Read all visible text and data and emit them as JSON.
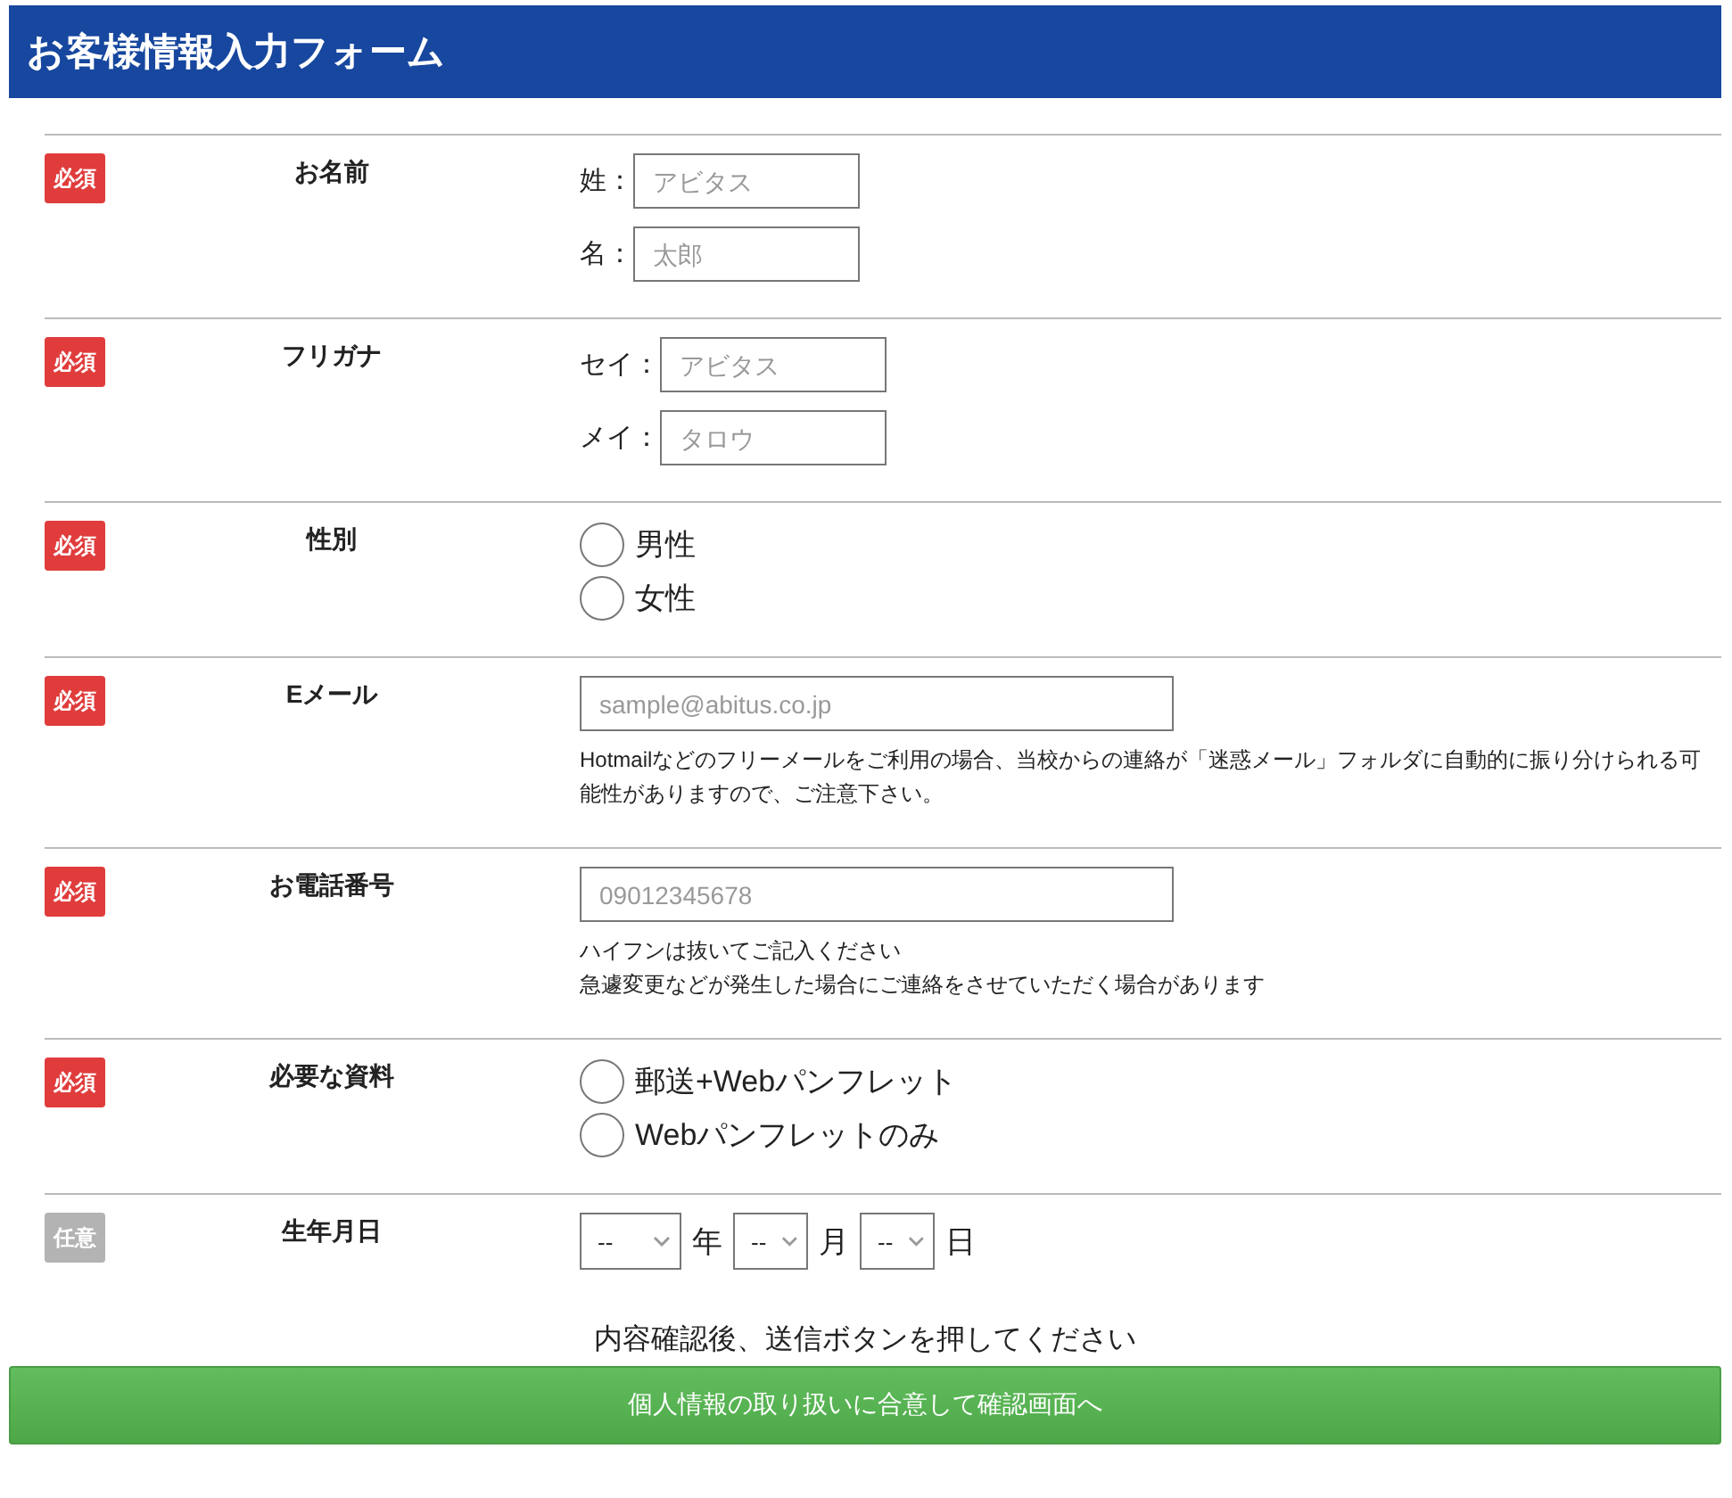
{
  "header": {
    "title": "お客様情報入力フォーム"
  },
  "rows": [
    {
      "kind": "pairs",
      "badge": "必須",
      "required": true,
      "label": "お名前",
      "fields": [
        {
          "label": "姓：",
          "placeholder": "アビタス"
        },
        {
          "label": "名：",
          "placeholder": "太郎"
        }
      ]
    },
    {
      "kind": "pairs",
      "badge": "必須",
      "required": true,
      "label": "フリガナ",
      "fields": [
        {
          "label": "セイ：",
          "placeholder": "アビタス"
        },
        {
          "label": "メイ：",
          "placeholder": "タロウ"
        }
      ]
    },
    {
      "kind": "radios",
      "badge": "必須",
      "required": true,
      "label": "性別",
      "options": [
        {
          "label": "男性",
          "selected": false
        },
        {
          "label": "女性",
          "selected": false
        }
      ]
    },
    {
      "kind": "input",
      "badge": "必須",
      "required": true,
      "label": "Eメール",
      "placeholder": "sample@abitus.co.jp",
      "notes": [
        "Hotmailなどのフリーメールをご利用の場合、当校からの連絡が「迷惑メール」フォルダに自動的に振り分けられる可能性がありますので、ご注意下さい。"
      ]
    },
    {
      "kind": "input",
      "badge": "必須",
      "required": true,
      "label": "お電話番号",
      "placeholder": "09012345678",
      "notes": [
        "ハイフンは抜いてご記入ください",
        "急遽変更などが発生した場合にご連絡をさせていただく場合があります"
      ]
    },
    {
      "kind": "radios",
      "badge": "必須",
      "required": true,
      "label": "必要な資料",
      "options": [
        {
          "label": "郵送+Webパンフレット",
          "selected": false
        },
        {
          "label": "Webパンフレットのみ",
          "selected": false
        }
      ]
    },
    {
      "kind": "date",
      "badge": "任意",
      "required": false,
      "label": "生年月日",
      "selects": [
        {
          "value": "--",
          "unit": "年"
        },
        {
          "value": "--",
          "unit": "月"
        },
        {
          "value": "--",
          "unit": "日"
        }
      ]
    }
  ],
  "footer": {
    "note": "内容確認後、送信ボタンを押してください",
    "button": "個人情報の取り扱いに合意して確認画面へ"
  }
}
